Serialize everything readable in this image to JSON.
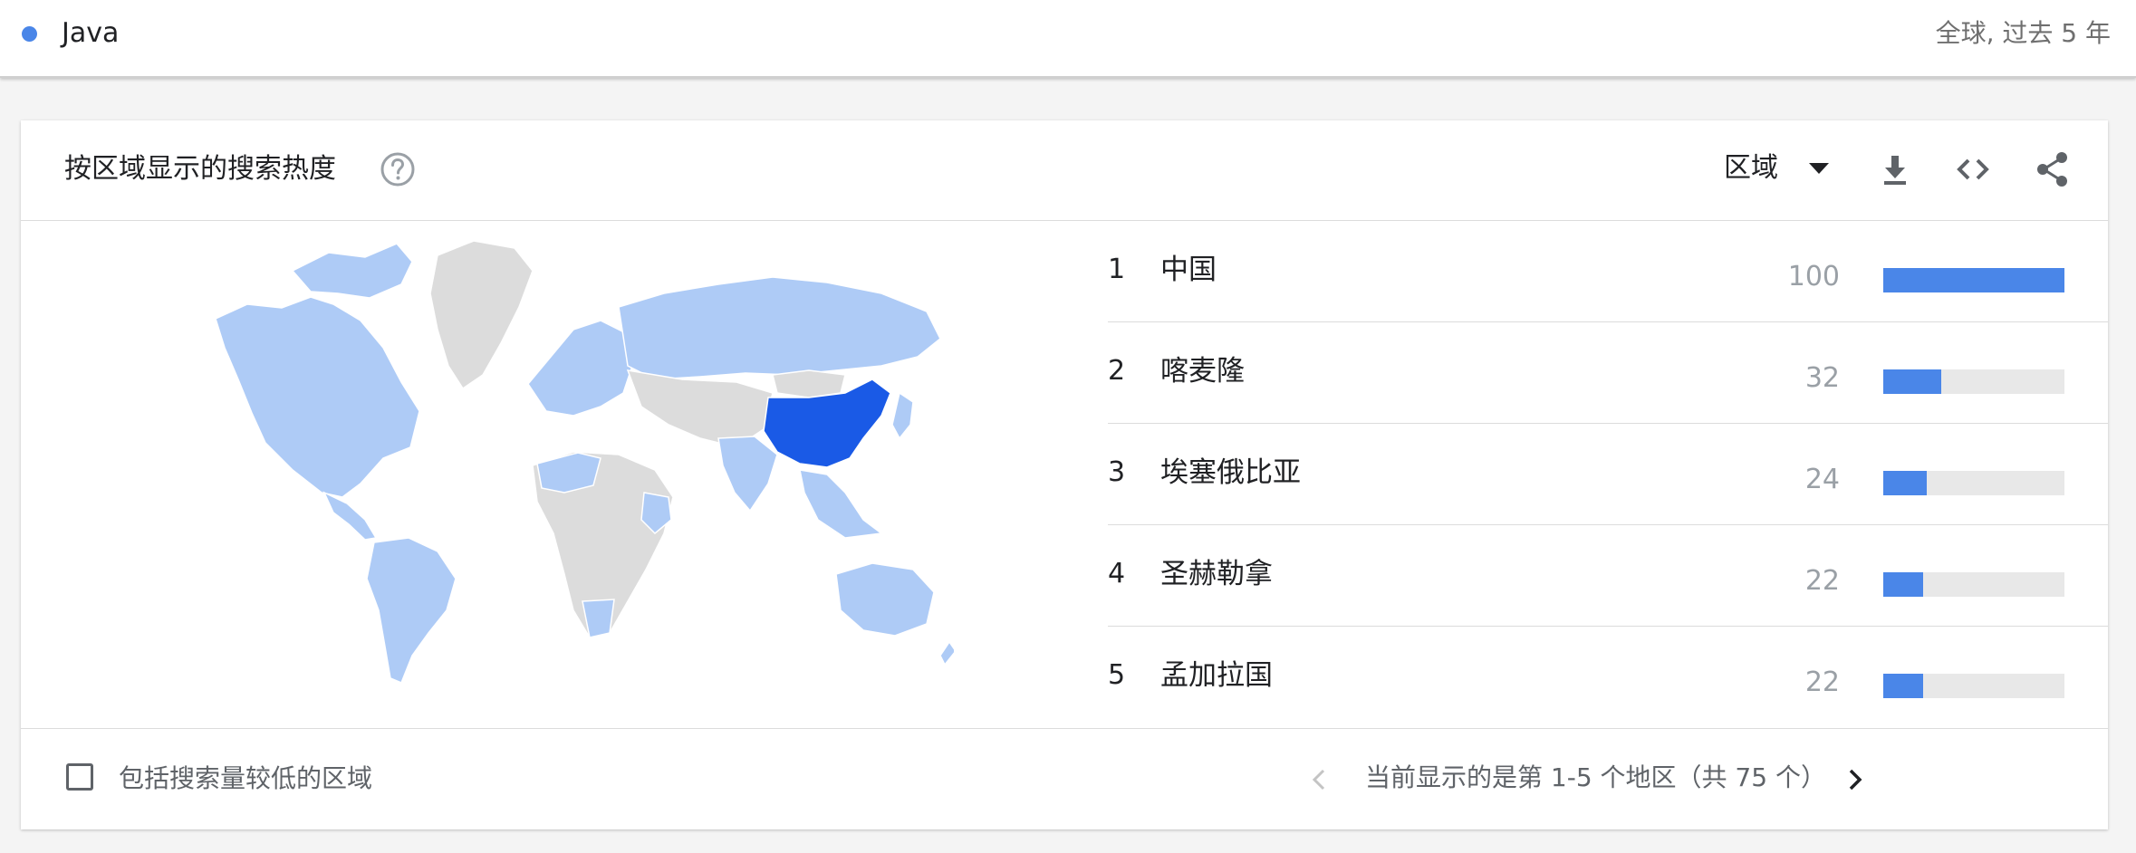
{
  "term": {
    "label": "Java",
    "dot_color": "#4a86e8",
    "scope": "全球, 过去 5 年"
  },
  "card": {
    "title": "按区域显示的搜索热度",
    "help_icon": "help-circle-icon",
    "region_select": "区域",
    "tools": [
      "download-icon",
      "embed-code-icon",
      "share-icon"
    ]
  },
  "map": {
    "highlight_color": "#1a5ae6",
    "data_color": "#aecbf6",
    "nodata_color": "#dcdcdc"
  },
  "rankings": [
    {
      "rank": "1",
      "name": "中国",
      "value": "100",
      "fraction": 1.0
    },
    {
      "rank": "2",
      "name": "喀麦隆",
      "value": "32",
      "fraction": 0.32
    },
    {
      "rank": "3",
      "name": "埃塞俄比亚",
      "value": "24",
      "fraction": 0.24
    },
    {
      "rank": "4",
      "name": "圣赫勒拿",
      "value": "22",
      "fraction": 0.22
    },
    {
      "rank": "5",
      "name": "孟加拉国",
      "value": "22",
      "fraction": 0.22
    }
  ],
  "footer": {
    "checkbox_label": "包括搜索量较低的区域",
    "pager_text": "当前显示的是第 1-5 个地区（共 75 个）"
  }
}
